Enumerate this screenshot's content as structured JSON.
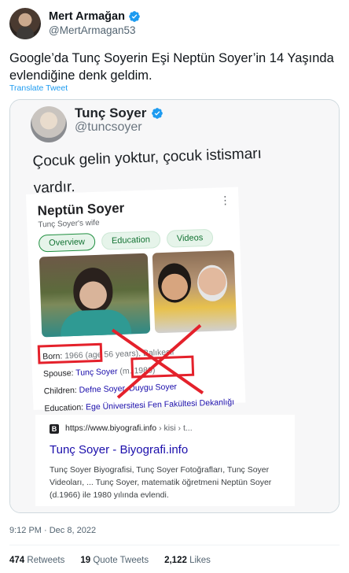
{
  "author": {
    "display_name": "Mert Armağan",
    "handle": "@MertArmagan53",
    "verified_icon": "verified-badge-icon"
  },
  "tweet": {
    "text": "Google’da Tunç Soyerin Eşi Neptün Soyer’in 14 Yaşında evlendiğine denk geldim.",
    "translate_label": "Translate Tweet",
    "timestamp": "9:12 PM · Dec 8, 2022"
  },
  "embedded_screenshot": {
    "inner_tweet": {
      "display_name": "Tunç Soyer",
      "handle": "@tuncsoyer",
      "text": "Çocuk gelin yoktur, çocuk istismarı vardır."
    },
    "knowledge_panel": {
      "title": "Neptün Soyer",
      "subtitle": "Tunç Soyer's wife",
      "chips": [
        "Overview",
        "Education",
        "Videos"
      ],
      "facts": {
        "born_label": "Born:",
        "born_value": "1966 (age 56 years), Balıkesir",
        "spouse_label": "Spouse:",
        "spouse_value": "Tunç Soyer",
        "spouse_extra": "(m. 1980)",
        "children_label": "Children:",
        "children_value": "Defne Soyer, Duygu Soyer",
        "education_label": "Education:",
        "education_value": "Ege Üniversitesi Fen Fakültesi Dekanlığı"
      }
    },
    "search_result": {
      "favicon_letter": "B",
      "url": "https://www.biyografi.info",
      "url_path": "› kisi › t...",
      "title": "Tunç Soyer - Biyografi.info",
      "snippet": "Tunç Soyer Biyografisi, Tunç Soyer Fotoğrafları, Tunç Soyer Videoları, ... Tunç Soyer, matematik öğretmeni Neptün Soyer (d.1966) ile 1980 yılında evlendi."
    },
    "annotation_color": "#e4212b"
  },
  "stats": {
    "retweets_count": "474",
    "retweets_label": "Retweets",
    "quotes_count": "19",
    "quotes_label": "Quote Tweets",
    "likes_count": "2,122",
    "likes_label": "Likes"
  },
  "colors": {
    "link_blue": "#1d9bf0",
    "verified_blue": "#1d9bf0",
    "muted_gray": "#536471"
  }
}
